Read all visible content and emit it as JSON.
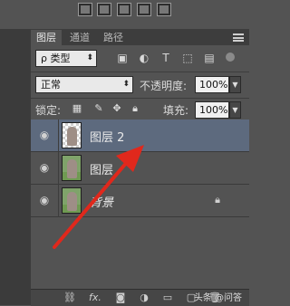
{
  "toolbar": {
    "buttons": [
      "align-icon-1",
      "align-icon-2",
      "align-icon-3",
      "align-icon-4",
      "align-icon-5"
    ]
  },
  "tabs": [
    {
      "label": "图层",
      "active": true
    },
    {
      "label": "通道",
      "active": false
    },
    {
      "label": "路径",
      "active": false
    }
  ],
  "filter": {
    "kind_label": "ρ 类型",
    "icons": [
      "image-filter-icon",
      "adjustment-filter-icon",
      "type-filter-icon",
      "shape-filter-icon",
      "smartobject-filter-icon"
    ]
  },
  "blend": {
    "mode": "正常",
    "opacity_label": "不透明度:",
    "opacity_value": "100%"
  },
  "lock": {
    "label": "锁定:",
    "fill_label": "填充:",
    "fill_value": "100%",
    "icons": [
      "lock-transparent-icon",
      "lock-paint-icon",
      "lock-move-icon",
      "lock-all-icon"
    ]
  },
  "layers": [
    {
      "name": "图层 2",
      "selected": true,
      "italic": false,
      "locked": false
    },
    {
      "name": "图层",
      "selected": false,
      "italic": false,
      "locked": false
    },
    {
      "name": "背景",
      "selected": false,
      "italic": true,
      "locked": true
    }
  ],
  "bottom_bar": {
    "icons": [
      "link-icon",
      "fx-icon",
      "mask-icon",
      "adjustment-icon",
      "group-icon",
      "new-layer-icon",
      "trash-icon"
    ],
    "fx_label": "fx."
  },
  "watermark": "头条 @问答",
  "annotation_color": "#e0281c"
}
